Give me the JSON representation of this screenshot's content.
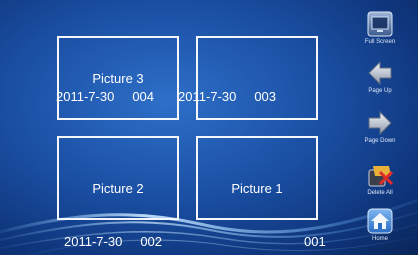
{
  "thumbnails": [
    {
      "name": "Picture 3",
      "date": "2011-7-30",
      "number": "004"
    },
    {
      "name": "",
      "date": "2011-7-30",
      "number": "003"
    },
    {
      "name": "Picture 2",
      "date": "2011-7-30",
      "number": "002"
    },
    {
      "name": "Picture 1",
      "date": "",
      "number": "001"
    }
  ],
  "sidebar": {
    "full_screen": {
      "label": "Full Screen",
      "icon": "full-screen-icon"
    },
    "page_up": {
      "label": "Page Up",
      "icon": "arrow-left-icon"
    },
    "page_down": {
      "label": "Page Down",
      "icon": "arrow-right-icon"
    },
    "delete_all": {
      "label": "Delete All",
      "icon": "delete-all-icon"
    },
    "home": {
      "label": "Home",
      "icon": "home-icon"
    }
  }
}
